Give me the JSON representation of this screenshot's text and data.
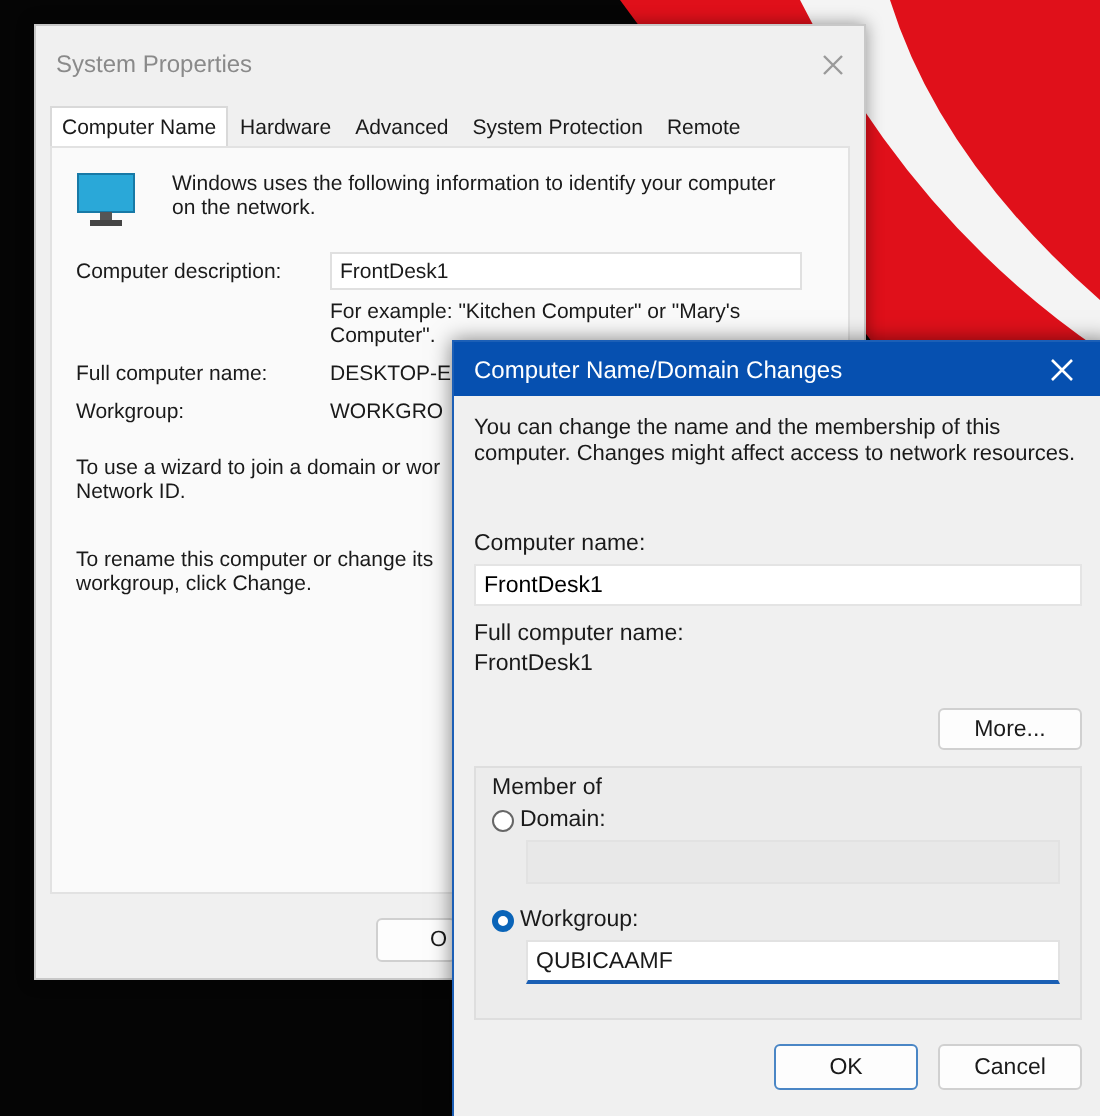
{
  "system_properties": {
    "title": "System Properties",
    "tabs": [
      {
        "label": "Computer Name",
        "selected": true
      },
      {
        "label": "Hardware",
        "selected": false
      },
      {
        "label": "Advanced",
        "selected": false
      },
      {
        "label": "System Protection",
        "selected": false
      },
      {
        "label": "Remote",
        "selected": false
      }
    ],
    "intro": "Windows uses the following information to identify your computer on the network.",
    "description_label": "Computer description:",
    "description_value": "FrontDesk1",
    "example_lines": [
      "For example: \"Kitchen Computer\" or \"Mary's",
      "Computer\"."
    ],
    "fields": [
      {
        "label": "Full computer name:",
        "value": "DESKTOP-E"
      },
      {
        "label": "Workgroup:",
        "value": "WORKGRO"
      }
    ],
    "network_id_lines": [
      "To use a wizard to join a domain or wor",
      "Network ID."
    ],
    "rename_lines": [
      "To rename this computer or change its",
      "workgroup, click Change."
    ],
    "button": "O"
  },
  "dialog": {
    "title": "Computer Name/Domain Changes",
    "intro": "You can change the name and the membership of this computer. Changes might affect access to network resources.",
    "computer_name_label": "Computer name:",
    "computer_name_value": "FrontDesk1",
    "full_name_label": "Full computer name:",
    "full_name_value": "FrontDesk1",
    "more_button": "More...",
    "member_of": "Member of",
    "options": [
      {
        "label": "Domain:",
        "selected": false
      },
      {
        "label": "Workgroup:",
        "selected": true,
        "value": "QUBICAAMF"
      }
    ],
    "buttons": [
      "OK",
      "Cancel"
    ]
  }
}
